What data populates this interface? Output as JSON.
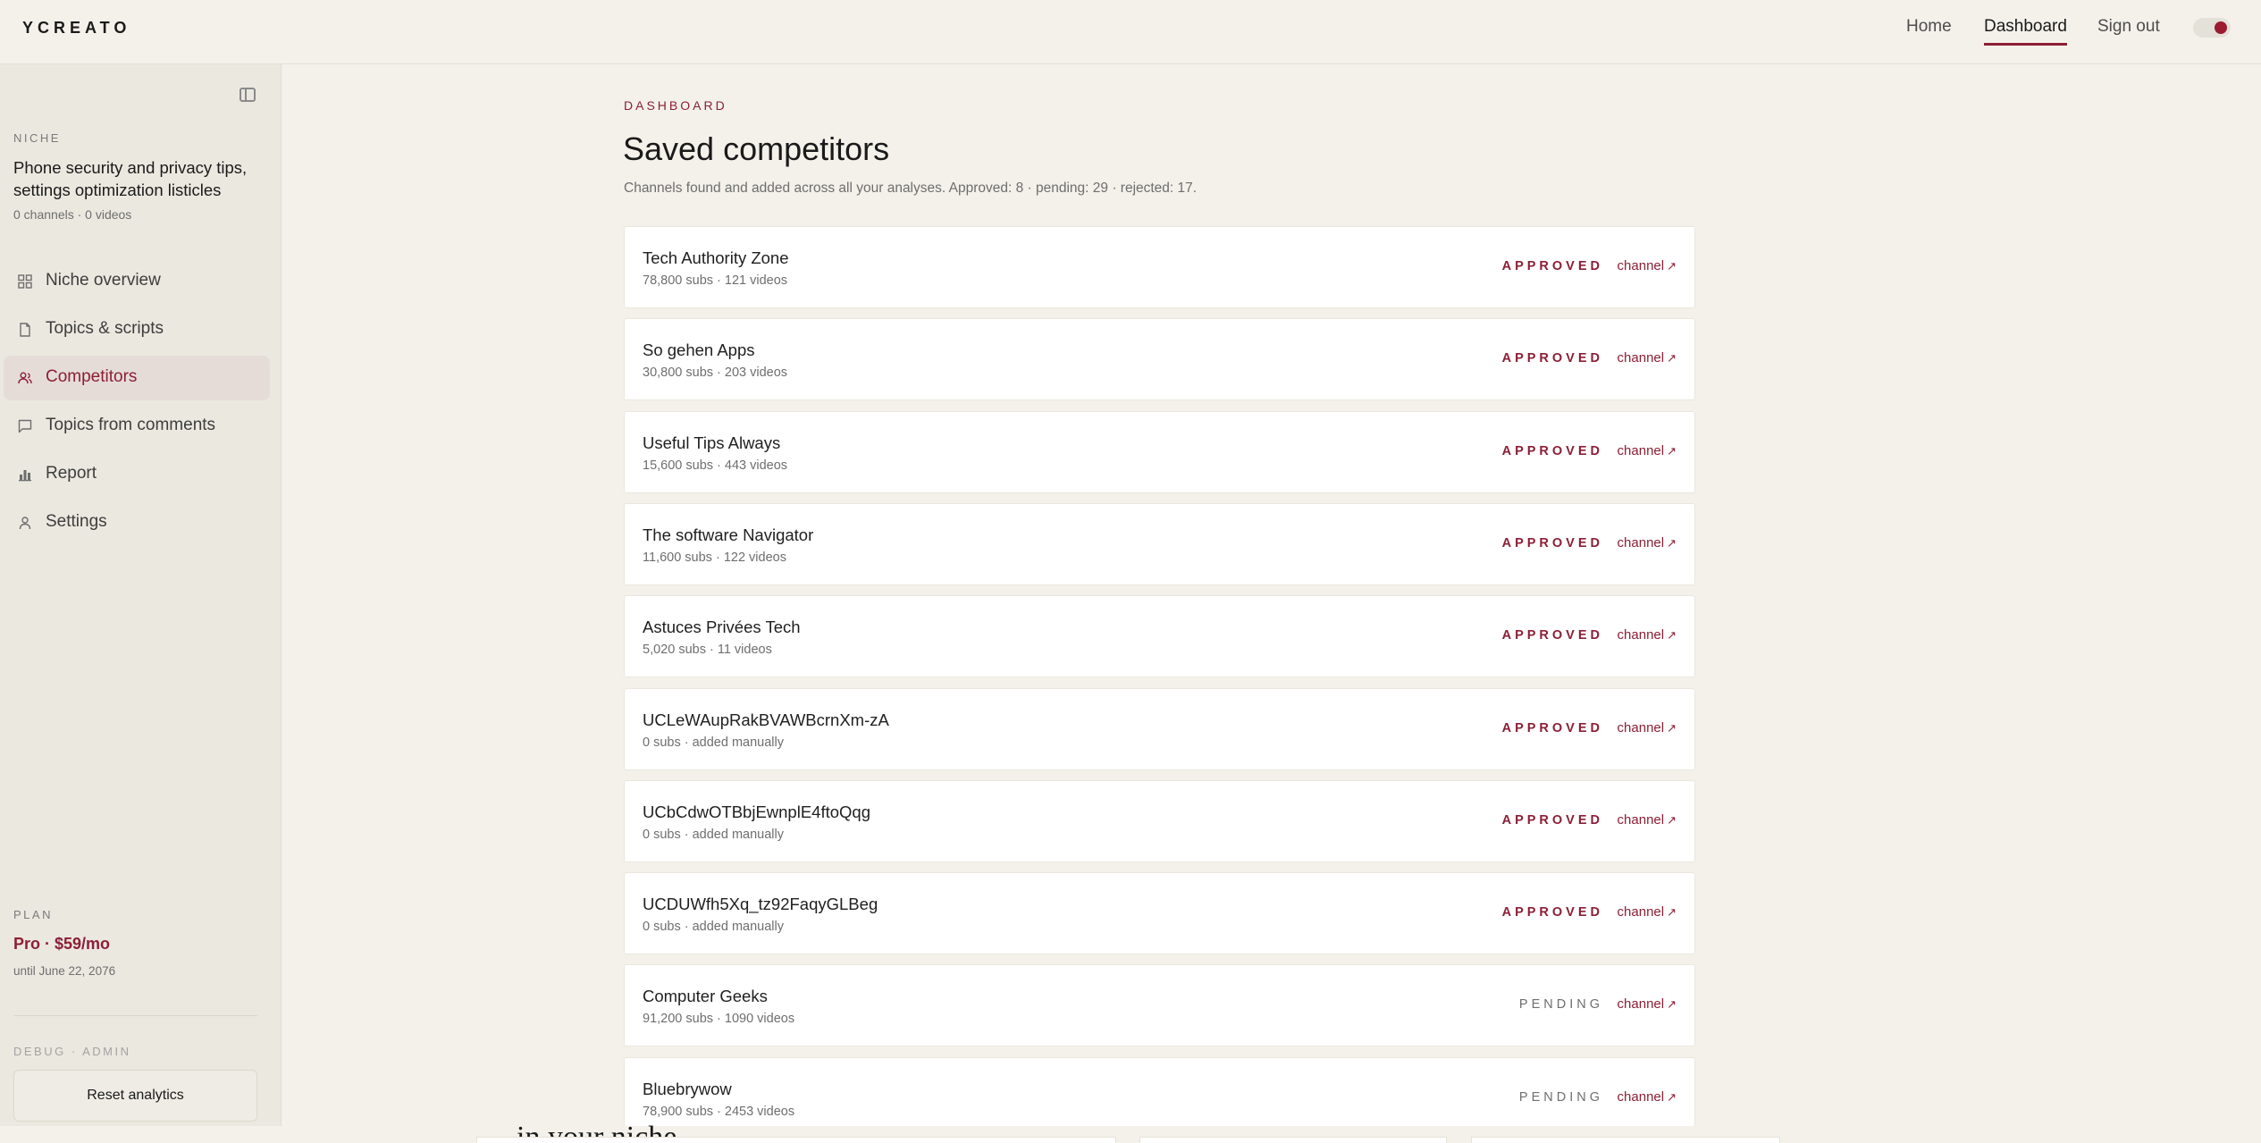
{
  "header": {
    "brand": "YCREATO",
    "nav": [
      {
        "label": "Home",
        "active": false
      },
      {
        "label": "Dashboard",
        "active": true
      },
      {
        "label": "Sign out",
        "active": false
      }
    ],
    "theme_toggle_color": "#9b1b31"
  },
  "sidebar": {
    "niche_label": "NICHE",
    "niche_title": "Phone security and privacy tips, settings optimization listicles",
    "niche_meta": "0 channels · 0 videos",
    "items": [
      {
        "label": "Niche overview",
        "icon": "grid-icon",
        "active": false
      },
      {
        "label": "Topics & scripts",
        "icon": "file-icon",
        "active": false
      },
      {
        "label": "Competitors",
        "icon": "users-icon",
        "active": true
      },
      {
        "label": "Topics from comments",
        "icon": "chat-icon",
        "active": false
      },
      {
        "label": "Report",
        "icon": "bar-chart-icon",
        "active": false
      },
      {
        "label": "Settings",
        "icon": "user-icon",
        "active": false
      }
    ],
    "plan_label": "PLAN",
    "plan_name": "Pro · $59/mo",
    "plan_until": "until June 22, 2076",
    "debug_label": "DEBUG · ADMIN",
    "reset_label": "Reset analytics"
  },
  "main": {
    "eyebrow": "DASHBOARD",
    "title": "Saved competitors",
    "subtitle": "Channels found and added across all your analyses. Approved: 8 · pending: 29 · rejected: 17.",
    "link_label": "channel",
    "competitors": [
      {
        "name": "Tech Authority Zone",
        "meta": "78,800 subs · 121 videos",
        "status": "APPROVED"
      },
      {
        "name": "So gehen Apps",
        "meta": "30,800 subs · 203 videos",
        "status": "APPROVED"
      },
      {
        "name": "Useful Tips Always",
        "meta": "15,600 subs · 443 videos",
        "status": "APPROVED"
      },
      {
        "name": "The software Navigator",
        "meta": "11,600 subs · 122 videos",
        "status": "APPROVED"
      },
      {
        "name": "Astuces Privées Tech",
        "meta": "5,020 subs · 11 videos",
        "status": "APPROVED"
      },
      {
        "name": "UCLeWAupRakBVAWBcrnXm-zA",
        "meta": "0 subs · added manually",
        "status": "APPROVED"
      },
      {
        "name": "UCbCdwOTBbjEwnplE4ftoQqg",
        "meta": "0 subs · added manually",
        "status": "APPROVED"
      },
      {
        "name": "UCDUWfh5Xq_tz92FaqyGLBeg",
        "meta": "0 subs · added manually",
        "status": "APPROVED"
      },
      {
        "name": "Computer Geeks",
        "meta": "91,200 subs · 1090 videos",
        "status": "PENDING"
      },
      {
        "name": "Bluebrywow",
        "meta": "78,900 subs · 2453 videos",
        "status": "PENDING"
      }
    ],
    "cutoff_text": "in your niche"
  }
}
